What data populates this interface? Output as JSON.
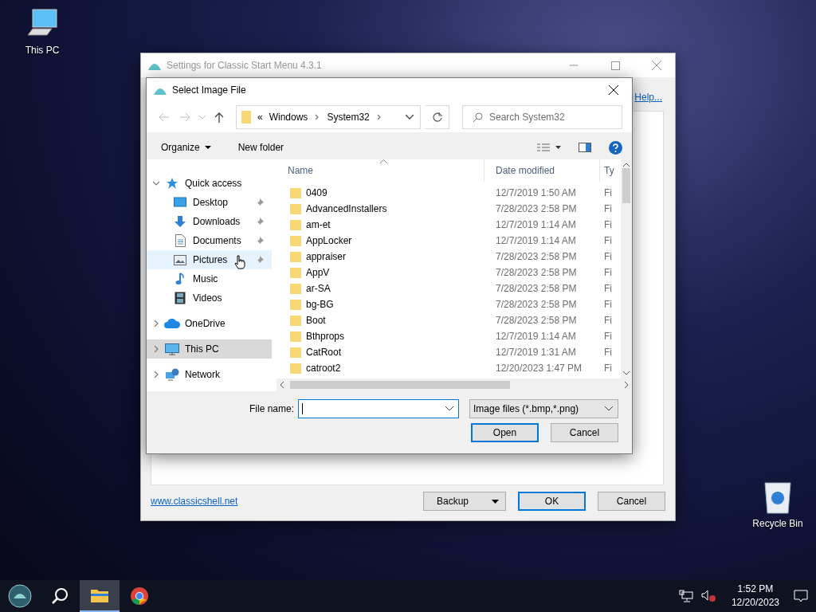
{
  "desktop_icons": [
    {
      "label": "This PC",
      "kind": "computer"
    },
    {
      "label": "Recycle Bin",
      "kind": "recycle"
    }
  ],
  "settings_window": {
    "title": "Settings for Classic Start Menu 4.3.1",
    "active": false,
    "help_link": "Help...",
    "website_link": "www.classicshell.net",
    "buttons": [
      {
        "label": "Backup",
        "kind": "split"
      },
      {
        "label": "OK",
        "kind": "default"
      },
      {
        "label": "Cancel",
        "kind": "normal"
      }
    ]
  },
  "dialog": {
    "title": "Select Image File",
    "active": true,
    "breadcrumb": {
      "overflow": "«",
      "parts": [
        "Windows",
        "System32"
      ]
    },
    "search": {
      "placeholder": "Search System32"
    },
    "toolbar": {
      "organize": "Organize",
      "new_folder": "New folder"
    },
    "nav": [
      {
        "label": "Quick access",
        "kind": "star",
        "expanded": true,
        "selected": false,
        "children": [
          {
            "label": "Desktop",
            "kind": "desktop",
            "pinned": true,
            "hovered": false
          },
          {
            "label": "Downloads",
            "kind": "download",
            "pinned": true,
            "hovered": false
          },
          {
            "label": "Documents",
            "kind": "document",
            "pinned": true,
            "hovered": false
          },
          {
            "label": "Pictures",
            "kind": "picture",
            "pinned": true,
            "hovered": true
          },
          {
            "label": "Music",
            "kind": "music",
            "pinned": false,
            "hovered": false
          },
          {
            "label": "Videos",
            "kind": "video",
            "pinned": false,
            "hovered": false
          }
        ]
      },
      {
        "label": "OneDrive",
        "kind": "cloud",
        "expanded": false,
        "selected": false
      },
      {
        "label": "This PC",
        "kind": "computer",
        "expanded": false,
        "selected": true
      },
      {
        "label": "Network",
        "kind": "network",
        "expanded": false,
        "selected": false
      }
    ],
    "columns": [
      {
        "label": "Name",
        "sorted": true
      },
      {
        "label": "Date modified",
        "sorted": false
      },
      {
        "label": "Ty",
        "sorted": false
      }
    ],
    "rows": [
      {
        "name": "0409",
        "date": "12/7/2019 1:50 AM",
        "type": "Fi"
      },
      {
        "name": "AdvancedInstallers",
        "date": "7/28/2023 2:58 PM",
        "type": "Fi"
      },
      {
        "name": "am-et",
        "date": "12/7/2019 1:14 AM",
        "type": "Fi"
      },
      {
        "name": "AppLocker",
        "date": "12/7/2019 1:14 AM",
        "type": "Fi"
      },
      {
        "name": "appraiser",
        "date": "7/28/2023 2:58 PM",
        "type": "Fi"
      },
      {
        "name": "AppV",
        "date": "7/28/2023 2:58 PM",
        "type": "Fi"
      },
      {
        "name": "ar-SA",
        "date": "7/28/2023 2:58 PM",
        "type": "Fi"
      },
      {
        "name": "bg-BG",
        "date": "7/28/2023 2:58 PM",
        "type": "Fi"
      },
      {
        "name": "Boot",
        "date": "7/28/2023 2:58 PM",
        "type": "Fi"
      },
      {
        "name": "Bthprops",
        "date": "12/7/2019 1:14 AM",
        "type": "Fi"
      },
      {
        "name": "CatRoot",
        "date": "12/7/2019 1:31 AM",
        "type": "Fi"
      },
      {
        "name": "catroot2",
        "date": "12/20/2023 1:47 PM",
        "type": "Fi"
      }
    ],
    "file_name": {
      "label": "File name:"
    },
    "file_type": "Image files (*.bmp,*.png)",
    "buttons": [
      {
        "label": "Open",
        "kind": "default"
      },
      {
        "label": "Cancel",
        "kind": "normal"
      }
    ]
  },
  "taskbar": {
    "apps": [
      {
        "kind": "start",
        "active": false
      },
      {
        "kind": "search",
        "active": false
      },
      {
        "kind": "explorer",
        "active": true
      },
      {
        "kind": "chrome",
        "active": false
      }
    ],
    "time": "1:52 PM",
    "date": "12/20/2023"
  }
}
